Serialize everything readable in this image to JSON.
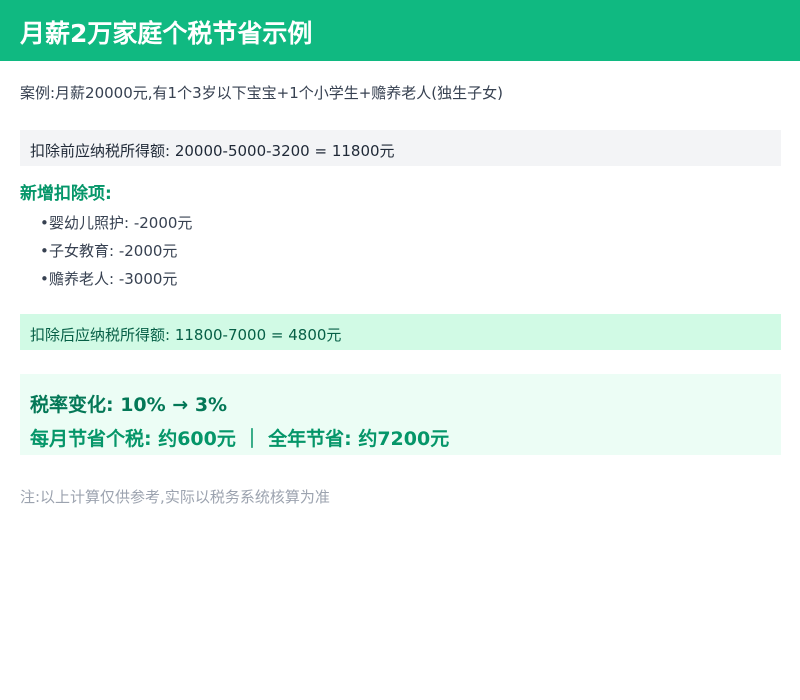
{
  "header": {
    "title": "月薪2万家庭个税节省示例",
    "background_color": "#10b981"
  },
  "case": {
    "text": "案例:月薪20000元,有1个3岁以下宝宝+1个小学生+赡养老人(独生子女)"
  },
  "before_deduction": {
    "text": "扣除前应纳税所得额: 20000-5000-3200 = 11800元"
  },
  "new_deductions": {
    "title": "新增扣除项:",
    "items": [
      {
        "label": "婴幼儿照护: -2000元"
      },
      {
        "label": "子女教育: -2000元"
      },
      {
        "label": "赡养老人: -3000元"
      }
    ]
  },
  "after_deduction": {
    "text": "扣除后应纳税所得额: 11800-7000 = 4800元"
  },
  "result": {
    "rate_change": "税率变化: 10% → 3%",
    "savings": "每月节省个税: 约600元 ｜ 全年节省: 约7200元"
  },
  "note": {
    "text": "注:以上计算仅供参考,实际以税务系统核算为准"
  },
  "colors": {
    "accent": "#10b981",
    "highlight_green": "#059669",
    "result_bg": "#ecfdf5",
    "after_bg": "#d1fae5",
    "before_bg": "#f3f4f6"
  }
}
